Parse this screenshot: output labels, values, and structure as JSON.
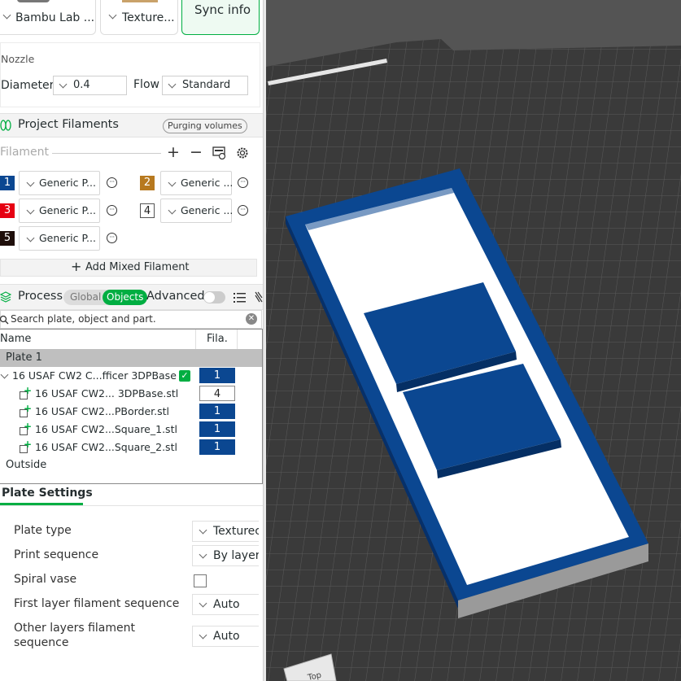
{
  "printer_card": {
    "label": "Bambu Lab ..."
  },
  "plate_card": {
    "label": "Texture..."
  },
  "sync_button": {
    "label": "Sync info"
  },
  "nozzle": {
    "section_label": "Nozzle",
    "diameter_label": "Diameter",
    "diameter_value": "0.4",
    "flow_label": "Flow",
    "flow_value": "Standard"
  },
  "filaments_section": {
    "title": "Project Filaments",
    "purging_button": "Purging volumes",
    "filament_label": "Filament",
    "add_mixed": "Add Mixed Filament",
    "items": [
      {
        "num": "1",
        "name": "Generic P...",
        "color": "#0b4791"
      },
      {
        "num": "2",
        "name": "Generic ...",
        "color": "#b7791f"
      },
      {
        "num": "3",
        "name": "Generic P...",
        "color": "#e60012"
      },
      {
        "num": "4",
        "name": "Generic ...",
        "color": "#ffffff"
      },
      {
        "num": "5",
        "name": "Generic P...",
        "color": "#1e0e0a"
      }
    ]
  },
  "process": {
    "title": "Process",
    "toggle_global": "Global",
    "toggle_objects": "Objects",
    "advanced_label": "Advanced",
    "search_placeholder": "Search plate, object and part.",
    "col_name": "Name",
    "col_fila": "Fila.",
    "plate_row": "Plate 1",
    "object": {
      "name": "16 USAF CW2 C...fficer 3DPBase",
      "fila": "1"
    },
    "parts": [
      {
        "name": "16 USAF CW2... 3DPBase.stl",
        "fila": "4"
      },
      {
        "name": "16 USAF CW2...PBorder.stl",
        "fila": "1"
      },
      {
        "name": "16 USAF CW2...Square_1.stl",
        "fila": "1"
      },
      {
        "name": "16 USAF CW2...Square_2.stl",
        "fila": "1"
      }
    ],
    "outside_label": "Outside"
  },
  "plate_settings": {
    "title": "Plate Settings",
    "plate_type": {
      "label": "Plate type",
      "value": "Texturec"
    },
    "print_sequence": {
      "label": "Print sequence",
      "value": "By layer"
    },
    "spiral_vase": {
      "label": "Spiral vase"
    },
    "first_layer_seq": {
      "label": "First layer filament sequence",
      "value": "Auto"
    },
    "other_layers_seq": {
      "label_line1": "Other layers filament",
      "label_line2": "sequence",
      "value": "Auto"
    }
  },
  "viewport": {
    "view_cube_label": "Top",
    "bed_color": "#3a3a3a",
    "accent_green": "#00ae42",
    "model_blue": "#0b4791"
  }
}
